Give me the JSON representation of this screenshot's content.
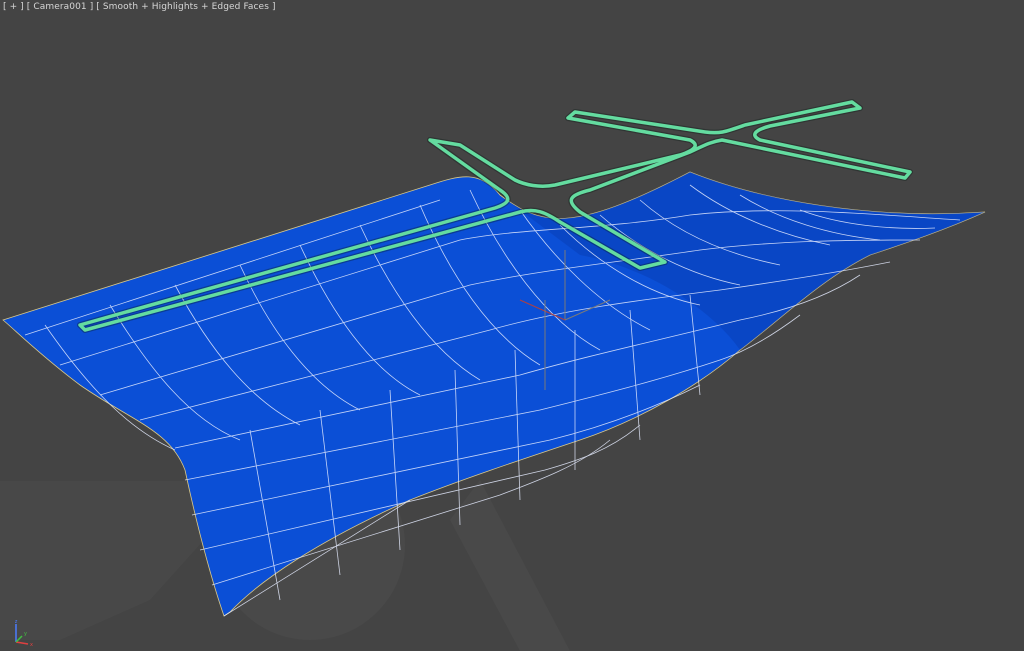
{
  "viewport": {
    "label_menu": "[ + ]",
    "label_camera": "[ Camera001 ]",
    "label_shading": "[ Smooth + Highlights + Edged Faces ]",
    "background_color": "#444444"
  },
  "scene": {
    "surface_color": "#0b4fd6",
    "wire_color": "#e6ecff",
    "spline_color": "#64dca0",
    "watermark_color": "#4b4b4b"
  },
  "gizmos": {
    "axis_icon": "xyz-axis-icon",
    "pivot_icon": "pivot-tripod-icon"
  }
}
